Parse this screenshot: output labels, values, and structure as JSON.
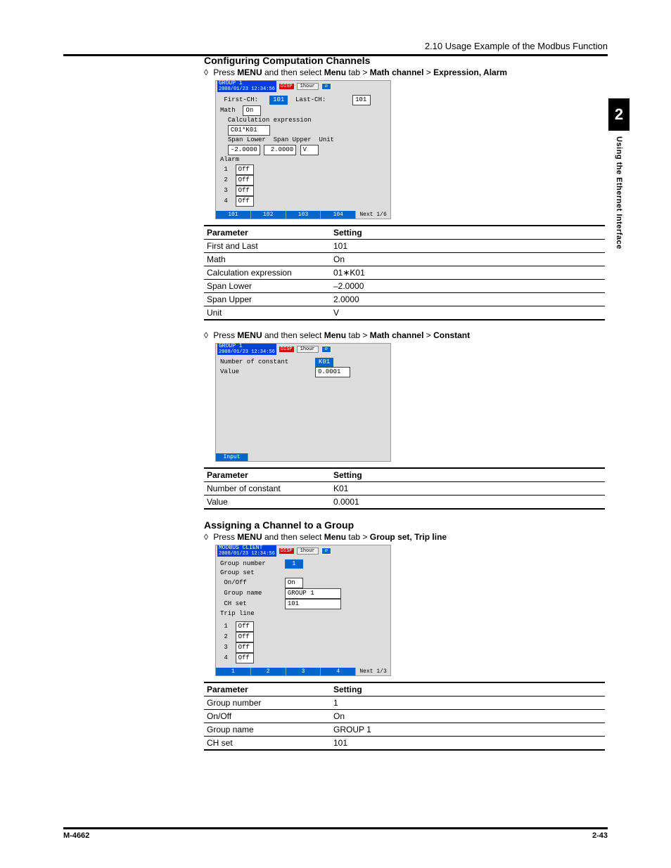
{
  "header": {
    "running_head": "2.10  Usage Example of the Modbus Function"
  },
  "sidetab": {
    "number": "2",
    "label": "Using the Ethernet Interface"
  },
  "sections": {
    "s1": {
      "title": "Configuring Computation Channels",
      "instruction_pre": "Press ",
      "instruction_rest": " and then select ",
      "path": [
        "MENU",
        "Menu",
        "Math channel",
        "Expression, Alarm"
      ],
      "dev": {
        "group": "GROUP 1",
        "timestamp": "2008/01/23 12:34:56",
        "disp": "DISP",
        "bar": "1hour",
        "first_label": "First-CH:",
        "first_val": "101",
        "last_label": "Last-CH:",
        "last_val": "101",
        "math_label": "Math",
        "math_val": "On",
        "calc_label": "Calculation expression",
        "calc_val": "C01*K01",
        "spL_label": "Span Lower",
        "spU_label": "Span Upper",
        "unit_label": "Unit",
        "spL_val": "-2.0000",
        "spU_val": "2.0000",
        "unit_val": "V",
        "alarm_label": "Alarm",
        "alarm_vals": [
          "Off",
          "Off",
          "Off",
          "Off"
        ],
        "footer": [
          "101",
          "102",
          "103",
          "104",
          "Next 1/6"
        ]
      },
      "table": {
        "hParam": "Parameter",
        "hSetting": "Setting",
        "rows": [
          {
            "p": "First and Last",
            "s": "101"
          },
          {
            "p": "Math",
            "s": "On"
          },
          {
            "p": "Calculation expression",
            "s": "01∗K01"
          },
          {
            "p": "Span Lower",
            "s": "–2.0000"
          },
          {
            "p": "Span Upper",
            "s": "2.0000"
          },
          {
            "p": "Unit",
            "s": "V"
          }
        ]
      }
    },
    "s2": {
      "instruction_pre": "Press ",
      "instruction_rest": " and then select ",
      "path": [
        "MENU",
        "Menu",
        "Math channel",
        "Constant"
      ],
      "dev": {
        "group": "GROUP 1",
        "timestamp": "2008/01/23 12:34:56",
        "disp": "DISP",
        "bar": "1hour",
        "num_label": "Number of constant",
        "num_val": "K01",
        "val_label": "Value",
        "val_val": "0.0001",
        "footer": [
          "Input"
        ]
      },
      "table": {
        "hParam": "Parameter",
        "hSetting": "Setting",
        "rows": [
          {
            "p": "Number of constant",
            "s": "K01"
          },
          {
            "p": "Value",
            "s": "0.0001"
          }
        ]
      }
    },
    "s3": {
      "title": "Assigning a Channel to a Group",
      "instruction_pre": "Press ",
      "instruction_rest": " and then select ",
      "path": [
        "MENU",
        "Menu",
        "Group set, Trip line"
      ],
      "dev": {
        "group": "MODBUS CLIENT",
        "timestamp": "2008/01/23 12:34:56",
        "disp": "DISP",
        "bar": "1hour",
        "gnum_label": "Group number",
        "gnum_val": "1",
        "gset_label": "Group set",
        "onoff_label": "On/Off",
        "onoff_val": "On",
        "gname_label": "Group name",
        "gname_val": "GROUP 1",
        "chset_label": "CH set",
        "chset_val": "101",
        "trip_label": "Trip line",
        "trip_vals": [
          "Off",
          "Off",
          "Off",
          "Off"
        ],
        "footer": [
          "1",
          "2",
          "3",
          "4",
          "Next 1/3"
        ]
      },
      "table": {
        "hParam": "Parameter",
        "hSetting": "Setting",
        "rows": [
          {
            "p": "Group number",
            "s": "1"
          },
          {
            "p": "On/Off",
            "s": "On"
          },
          {
            "p": "Group name",
            "s": "GROUP 1"
          },
          {
            "p": "CH set",
            "s": "101"
          }
        ]
      }
    }
  },
  "footer": {
    "left": "M-4662",
    "right": "2-43"
  }
}
